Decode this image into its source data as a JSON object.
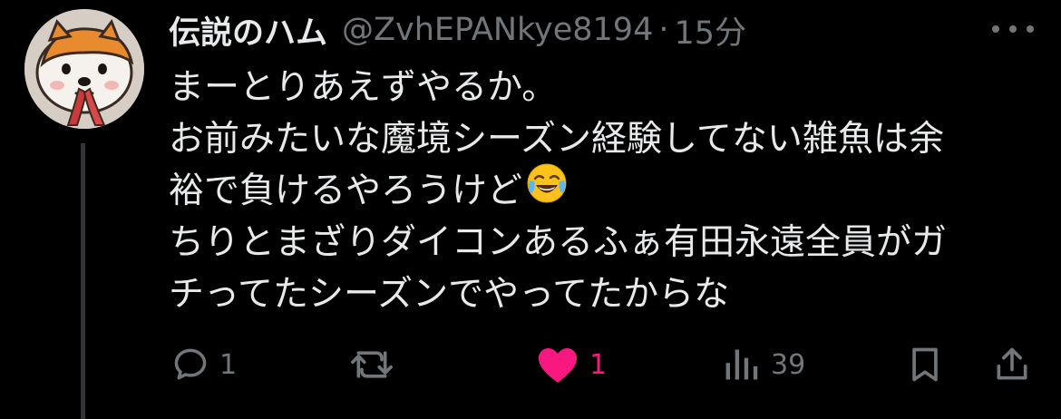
{
  "tweet": {
    "display_name": "伝説のハム",
    "handle": "@ZvhEPANkye8194",
    "separator": "·",
    "time": "15分",
    "lines": [
      "まーとりあえずやるか。",
      "お前みたいな魔境シーズン経験してない雑魚は余",
      "裕で負けるやろうけど",
      "ちりとまざりダイコンあるふぁ有田永遠全員がガ",
      "チってたシーズンでやってたからな"
    ],
    "emoji": "face-with-tears-of-joy"
  },
  "actions": {
    "reply_count": "1",
    "retweet_count": "",
    "like_count": "1",
    "view_count": "39"
  },
  "colors": {
    "background": "#000000",
    "text": "#e7e9ea",
    "secondary": "#71767b",
    "like": "#f91880",
    "thread_line": "#333639"
  },
  "icons": [
    "more-icon",
    "reply-icon",
    "retweet-icon",
    "like-icon",
    "views-icon",
    "bookmark-icon",
    "share-icon"
  ]
}
